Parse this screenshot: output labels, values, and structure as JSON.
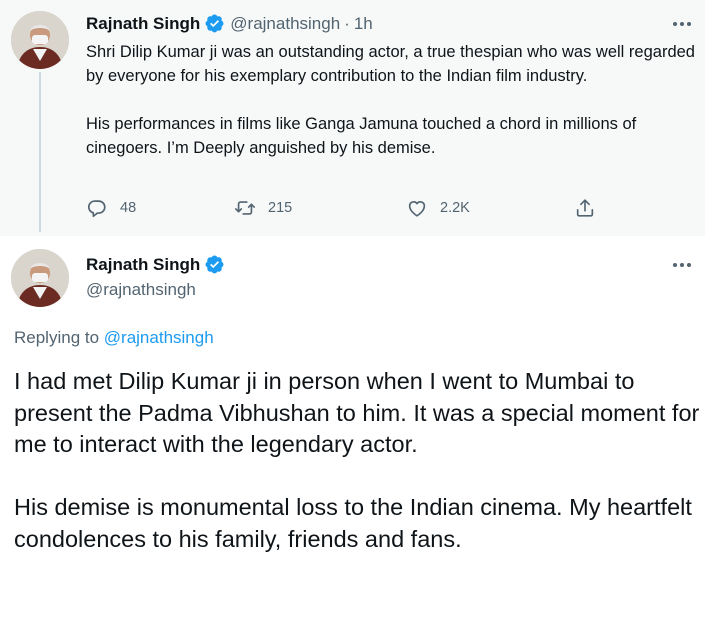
{
  "tweet1": {
    "name": "Rajnath Singh",
    "handle": "@rajnathsingh",
    "separator": "·",
    "time": "1h",
    "paragraphs": [
      "Shri Dilip Kumar ji was an outstanding actor, a true thespian who was well regarded by everyone for his exemplary contribution to the Indian film industry.",
      "His performances in films like Ganga Jamuna touched a chord in millions of cinegoers. I’m  Deeply anguished by his demise."
    ],
    "actions": {
      "replies": "48",
      "retweets": "215",
      "likes": "2.2K"
    }
  },
  "tweet2": {
    "name": "Rajnath Singh",
    "handle": "@rajnathsingh",
    "replying_prefix": "Replying to ",
    "replying_handle": "@rajnathsingh",
    "paragraphs": [
      "I had met Dilip Kumar ji in person when I went to Mumbai to present the Padma Vibhushan to him. It was a special moment for me to interact with the legendary actor.",
      "His demise is monumental loss to the Indian cinema. My heartfelt condolences to his family, friends and fans."
    ]
  },
  "colors": {
    "accent": "#1d9bf0",
    "secondary_text": "#536471",
    "primary_text": "#0f1419",
    "highlight_background": "#f7f9f9"
  }
}
